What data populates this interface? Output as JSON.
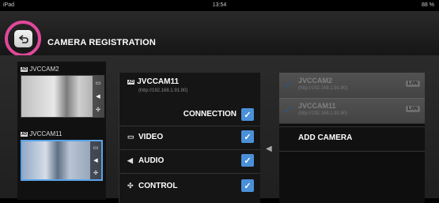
{
  "status": {
    "left": "iPad",
    "time": "13:54",
    "battery": "88 %"
  },
  "header": {
    "title": "CAMERA REGISTRATION"
  },
  "cameras": [
    {
      "tag": "AD",
      "name": "JVCCAM2"
    },
    {
      "tag": "AD",
      "name": "JVCCAM11"
    }
  ],
  "settings": {
    "tag": "AD",
    "name": "JVCCAM11",
    "url": "(http://192.168.1.91:80)",
    "connection_label": "CONNECTION",
    "video_label": "VIDEO",
    "audio_label": "AUDIO",
    "control_label": "CONTROL"
  },
  "registered": [
    {
      "name": "JVCCAM2",
      "url": "(http://192.168.1.91:80)",
      "badge": "LAN"
    },
    {
      "name": "JVCCAM11",
      "url": "(http://192.168.1.91:80)",
      "badge": "LAN"
    }
  ],
  "add_camera_label": "ADD CAMERA",
  "colors": {
    "accent": "#4a90d9",
    "highlight_ring": "#e0489a"
  }
}
